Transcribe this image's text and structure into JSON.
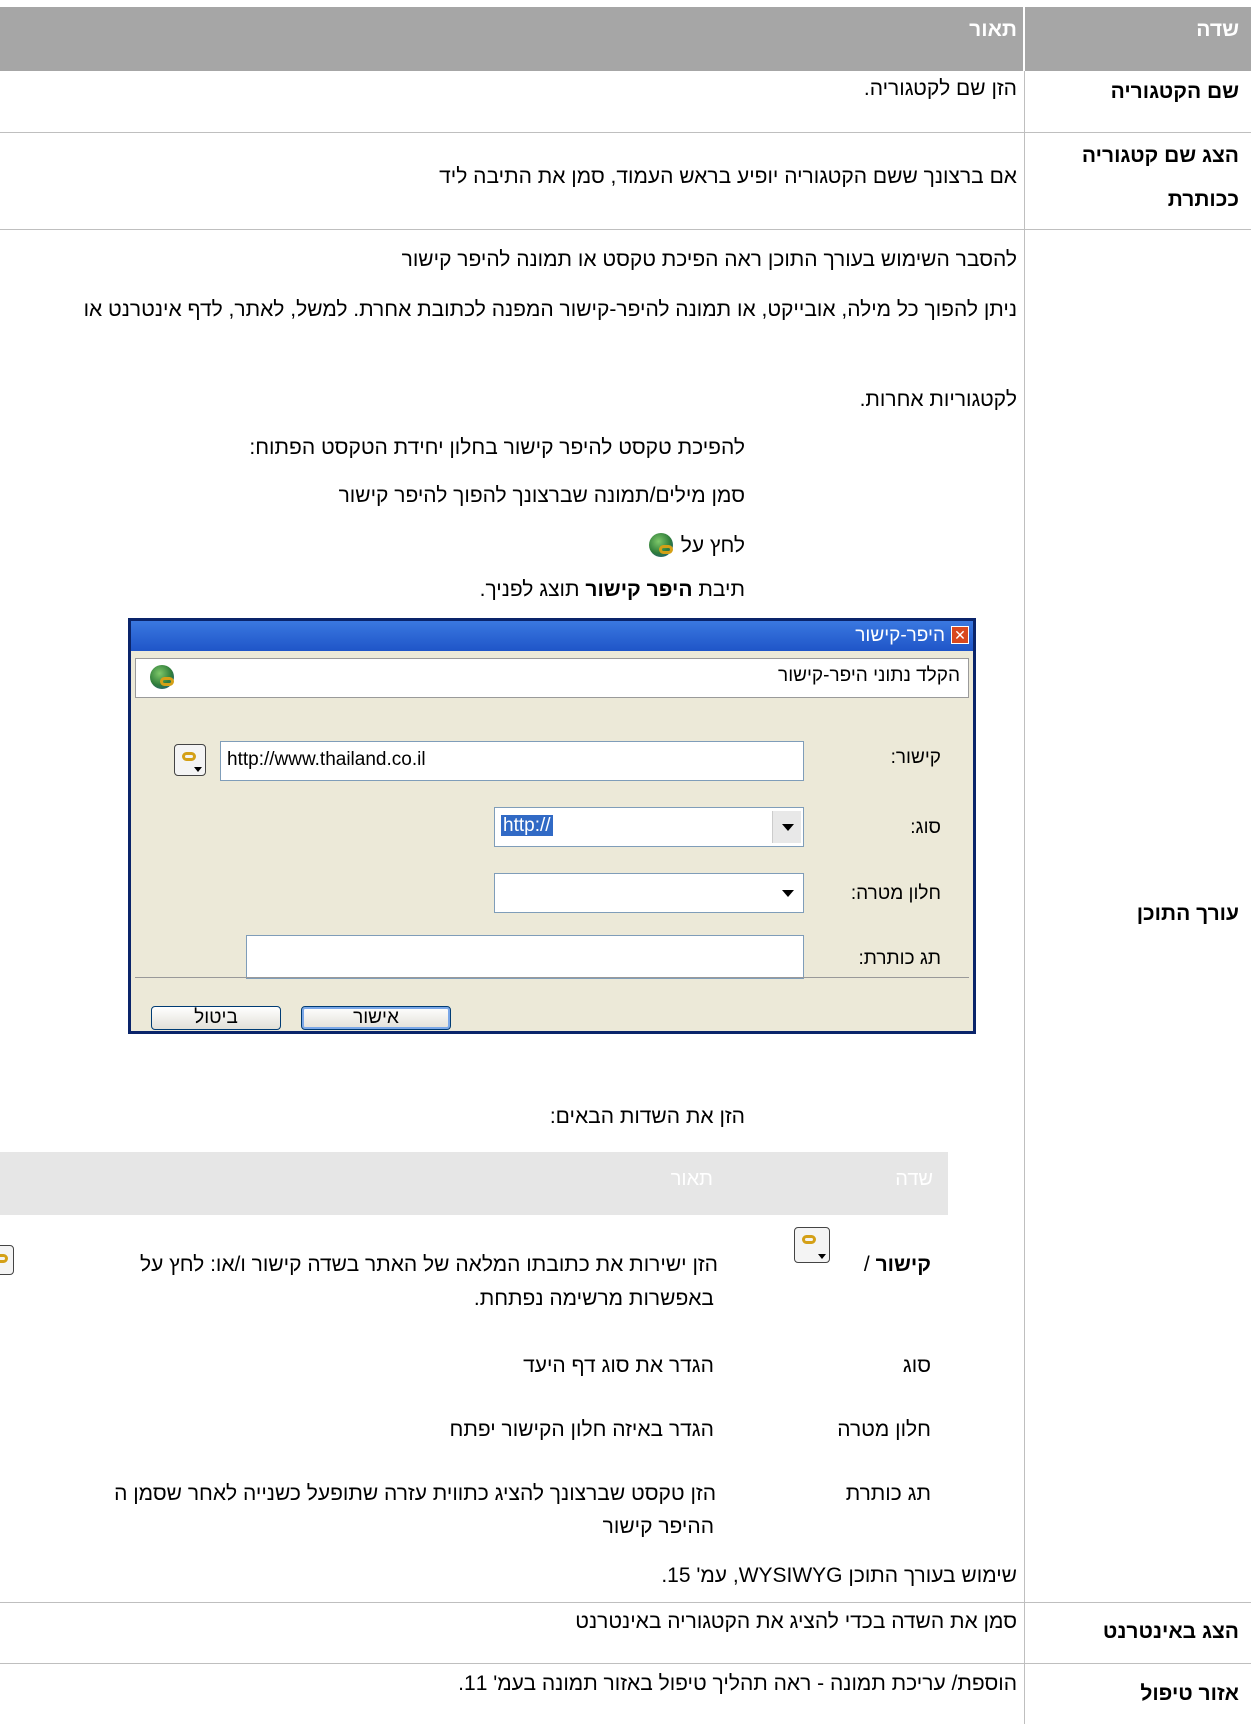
{
  "table": {
    "headers": {
      "field": "שדה",
      "description": "תאור"
    },
    "rows": {
      "category_name": {
        "label": "שם הקטגוריה",
        "description": "הזן שם לקטגוריה."
      },
      "show_title": {
        "label_line1": "הצג שם קטגוריה",
        "label_line2": "ככותרת",
        "description": "אם ברצונך ששם הקטגוריה יופיע בראש העמוד, סמן את התיבה ליד"
      },
      "content_editor": {
        "label": "עורך התוכן",
        "para1": "להסבר השימוש בעורך התוכן ראה הפיכת טקסט או תמונה להיפר קישור",
        "para2": "ניתן להפוך כל מילה, אובייקט, או תמונה להיפר-קישור המפנה לכתובת אחרת. למשל, לאתר, לדף אינטרנט או",
        "para3": "לקטגוריות אחרות.",
        "step_intro": "להפיכת טקסט להיפר קישור בחלון יחידת הטקסט הפתוח:",
        "step1": "סמן מילים/תמונה שברצונך להפוך להיפר קישור",
        "step2": "לחץ על",
        "step3_pre": "תיבת",
        "step3_bold": "היפר קישור",
        "step3_post": "תוצג לפניך.",
        "fields_intro": "הזן את השדות הבאים:",
        "subtable": {
          "headers": {
            "field": "שדה",
            "description": "תאור"
          },
          "rows": [
            {
              "field_bold": "קישור",
              "field_rest": " / ",
              "description": "הזן  ישירות את כתובתו המלאה של האתר בשדה קישור ו/או: לחץ על",
              "description_line2": "באפשרות מרשימה נפתחת."
            },
            {
              "field": "סוג",
              "description": "הגדר את סוג דף היעד"
            },
            {
              "field": "חלון מטרה",
              "description": "הגדר באיזה חלון הקישור יפתח"
            },
            {
              "field": "תג כותרת",
              "description": "הזן טקסט שברצונך להציג כתווית עזרה שתופעל כשנייה לאחר שסמן ה",
              "description_line2": "ההיפר קישור"
            }
          ]
        },
        "reference": "שימוש בעורך התוכן WYSIWYG, עמ' 15."
      },
      "show_internet": {
        "label": "הצג באינטרנט",
        "description": "סמן את השדה בכדי להציג את הקטגוריה באינטרנט"
      },
      "handling_area": {
        "label": "אזור טיפול",
        "description": "הוספת/ עריכת תמונה - ראה תהליך טיפול באזור תמונה בעמ' 11."
      }
    }
  },
  "dialog": {
    "title": "היפר-קישור",
    "subtitle": "הקלד נתוני היפר-קישור",
    "link_label": "קישור:",
    "link_value": "http://www.thailand.co.il",
    "type_label": "סוג:",
    "type_value": "http://",
    "target_label": "חלון מטרה:",
    "target_value": "",
    "tooltip_label": "תג כותרת:",
    "tooltip_value": "",
    "ok_label": "אישור",
    "cancel_label": "ביטול"
  }
}
